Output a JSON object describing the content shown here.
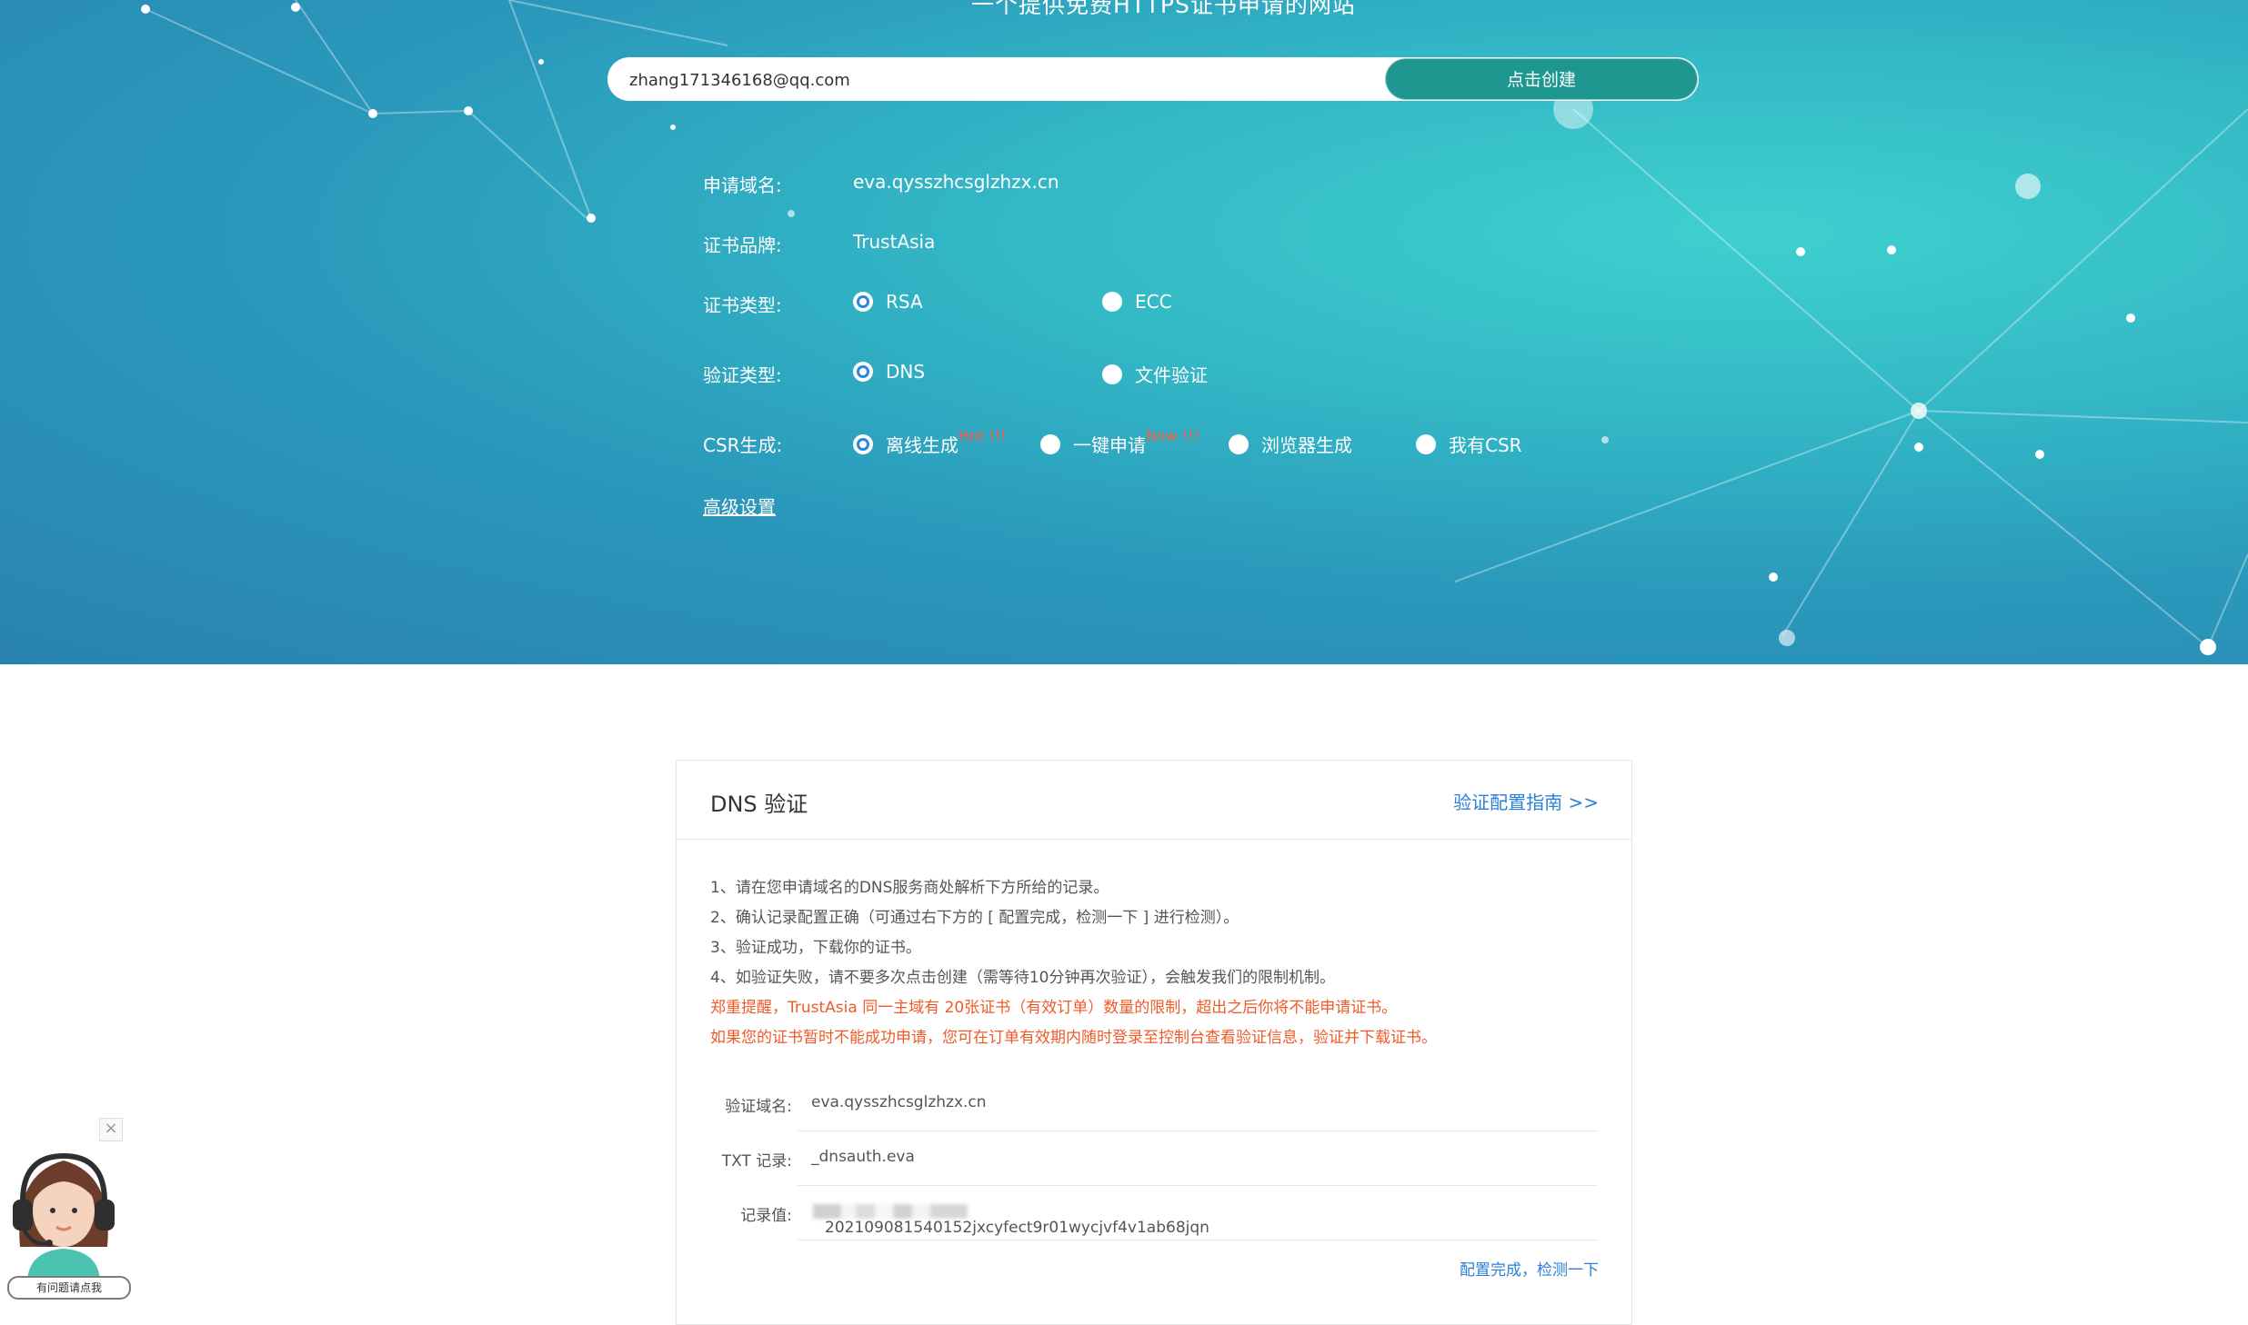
{
  "hero": {
    "subtitle": "一个提供免费HTTPS证书申请的网站",
    "email_value": "zhang171346168@qq.com",
    "create_button": "点击创建",
    "domain_label": "申请域名:",
    "domain_value": "eva.qysszhcsglzhzx.cn",
    "brand_label": "证书品牌:",
    "brand_value": "TrustAsia",
    "cert_type_label": "证书类型:",
    "cert_type_options": [
      "RSA",
      "ECC"
    ],
    "cert_type_selected": "RSA",
    "verify_type_label": "验证类型:",
    "verify_type_options": [
      "DNS",
      "文件验证"
    ],
    "verify_type_selected": "DNS",
    "csr_label": "CSR生成:",
    "csr_options": [
      {
        "label": "离线生成",
        "badge": "Hot !!!"
      },
      {
        "label": "一键申请",
        "badge": "Now !!!"
      },
      {
        "label": "浏览器生成",
        "badge": ""
      },
      {
        "label": "我有CSR",
        "badge": ""
      }
    ],
    "csr_selected": "离线生成",
    "advanced_link": "高级设置"
  },
  "dns_card": {
    "title": "DNS 验证",
    "guide_link": "验证配置指南 >>",
    "steps": [
      "1、请在您申请域名的DNS服务商处解析下方所给的记录。",
      "2、确认记录配置正确（可通过右下方的 [ 配置完成，检测一下 ] 进行检测）。",
      "3、验证成功，下载你的证书。",
      "4、如验证失败，请不要多次点击创建（需等待10分钟再次验证），会触发我们的限制机制。"
    ],
    "warnings": [
      "郑重提醒，TrustAsia 同一主域有 20张证书（有效订单）数量的限制，超出之后你将不能申请证书。",
      "如果您的证书暂时不能成功申请，您可在订单有效期内随时登录至控制台查看验证信息，验证并下载证书。"
    ],
    "verify_domain_label": "验证域名:",
    "verify_domain_value": "eva.qysszhcsglzhzx.cn",
    "txt_label": "TXT 记录:",
    "txt_value": "_dnsauth.eva",
    "record_label": "记录值:",
    "record_value": "202109081540152jxcyfect9r01wycjvf4v1ab68jqn",
    "done_link": "配置完成，检测一下"
  },
  "helper": {
    "close": "×",
    "tag": "有问题请点我"
  },
  "colors": {
    "accent_button": "#1d978f",
    "link": "#2b7fd8",
    "warning": "#f05a28",
    "badge": "#ff5a3c"
  }
}
